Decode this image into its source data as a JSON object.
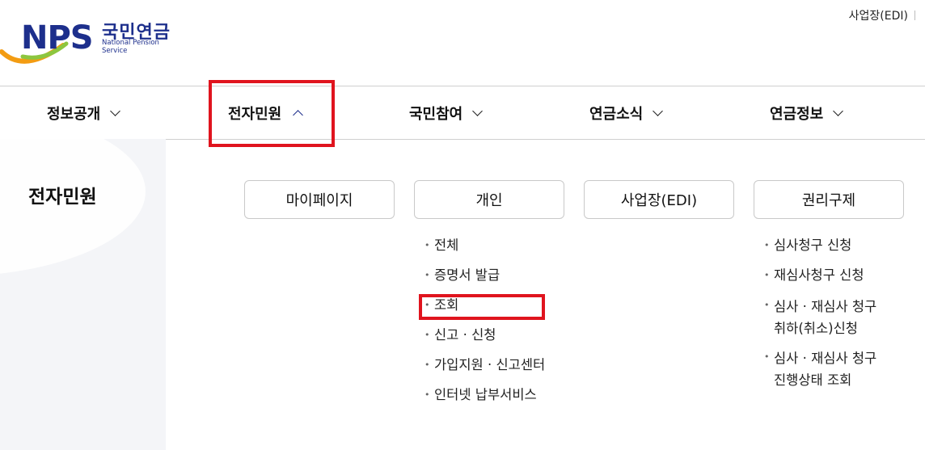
{
  "brand": {
    "logo_mark": "NPS",
    "name_kr": "국민연금",
    "name_en": "National Pension Service"
  },
  "utility": {
    "edi_link": "사업장(EDI)"
  },
  "gnb": [
    {
      "label": "정보공개",
      "state": "collapsed"
    },
    {
      "label": "전자민원",
      "state": "expanded"
    },
    {
      "label": "국민참여",
      "state": "collapsed"
    },
    {
      "label": "연금소식",
      "state": "collapsed"
    },
    {
      "label": "연금정보",
      "state": "collapsed"
    }
  ],
  "submenu": {
    "section_title": "전자민원",
    "categories": [
      "마이페이지",
      "개인",
      "사업장(EDI)",
      "권리구제"
    ],
    "personal_items": [
      "전체",
      "증명서 발급",
      "조회",
      "신고 · 신청",
      "가입지원 · 신고센터",
      "인터넷 납부서비스"
    ],
    "rights_items": [
      {
        "line1": "심사청구 신청",
        "line2": ""
      },
      {
        "line1": "재심사청구 신청",
        "line2": ""
      },
      {
        "line1": "심사 · 재심사 청구",
        "line2": "취하(취소)신청"
      },
      {
        "line1": "심사 · 재심사 청구",
        "line2": "진행상태 조회"
      }
    ]
  },
  "colors": {
    "brand_navy": "#1d2f8c",
    "highlight_red": "#e0141e",
    "side_bg": "#f4f5f8"
  }
}
